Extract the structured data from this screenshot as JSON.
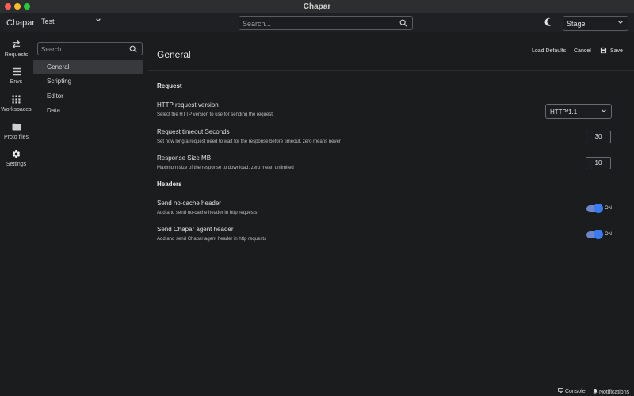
{
  "window": {
    "title": "Chapar"
  },
  "header": {
    "brand": "Chapar",
    "workspace": "Test",
    "search_placeholder": "Search...",
    "environment": "Stage"
  },
  "rail": {
    "items": [
      {
        "label": "Requests",
        "icon": "swap-arrows-icon"
      },
      {
        "label": "Envs",
        "icon": "menu-lines-icon"
      },
      {
        "label": "Workspaces",
        "icon": "grid-dots-icon"
      },
      {
        "label": "Proto files",
        "icon": "folder-icon"
      },
      {
        "label": "Settings",
        "icon": "gear-icon"
      }
    ]
  },
  "settings_nav": {
    "search_placeholder": "Search...",
    "items": [
      {
        "label": "General",
        "active": true
      },
      {
        "label": "Scripting",
        "active": false
      },
      {
        "label": "Editor",
        "active": false
      },
      {
        "label": "Data",
        "active": false
      }
    ]
  },
  "main": {
    "title": "General",
    "actions": {
      "load_defaults": "Load Defaults",
      "cancel": "Cancel",
      "save": "Save"
    },
    "sections": {
      "request": {
        "title": "Request",
        "http_version": {
          "title": "HTTP request version",
          "desc": "Select the HTTP version to use for sending the request.",
          "value": "HTTP/1.1"
        },
        "timeout": {
          "title": "Request timeout Seconds",
          "desc": "Set how long a request need to wait for the response before timeout, zero means never",
          "value": "30"
        },
        "response_size": {
          "title": "Response Size MB",
          "desc": "Maximum size of the response to download. zero mean unlimited",
          "value": "10"
        }
      },
      "headers": {
        "title": "Headers",
        "no_cache": {
          "title": "Send no-cache header",
          "desc": "Add and send no-cache header in http requests",
          "state": "ON"
        },
        "agent": {
          "title": "Send Chapar agent header",
          "desc": "Add and send Chapar agent header in http requests",
          "state": "ON"
        }
      }
    }
  },
  "statusbar": {
    "console": "Console",
    "notifications": "Notifications"
  },
  "colors": {
    "accent": "#3a7bf0",
    "background": "#1b1c1e",
    "active_nav": "#38393c"
  }
}
